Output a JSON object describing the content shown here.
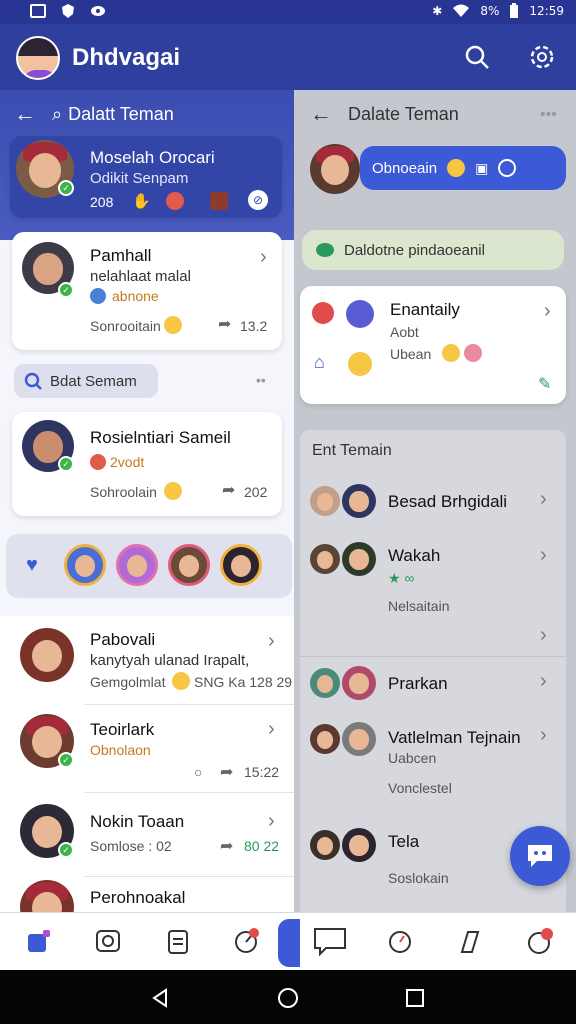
{
  "status_bar": {
    "battery": "8%",
    "time": "12:59"
  },
  "header": {
    "title": "Dhdvagai"
  },
  "left": {
    "subheader": "Dalatt Teman",
    "profile": {
      "name": "Moselah Orocari",
      "status": "Odikit Senpam",
      "count": "208"
    },
    "card1": {
      "name": "Pamhall",
      "line1": "nelahlaat malal",
      "tag": "abnone",
      "action": "Sonrooitain",
      "stat": "13.2"
    },
    "search_pill": "Bdat Semam",
    "card2": {
      "name": "Rosielntiari Sameil",
      "tag": "2vodt",
      "action": "Sohroolain",
      "stat": "202"
    },
    "list": [
      {
        "name": "Pabovali",
        "line1": "kanytyah ulanad Irapalt,",
        "line2": "Gemgolmlat",
        "extra": "SNG Ka 128 29"
      },
      {
        "name": "Teoirlark",
        "line1": "Obnolaon",
        "line2": "",
        "extra": "15:22"
      },
      {
        "name": "Nokin Toaan",
        "line1": "Somlose : 02",
        "line2": "",
        "extra": "80 22"
      },
      {
        "name": "Perohnoakal",
        "line1": "",
        "line2": "",
        "extra": ""
      }
    ]
  },
  "right": {
    "subheader": "Dalate Teman",
    "bubble": "Obnoeain",
    "pill": "Daldotne pindaoeanil",
    "card": {
      "name": "Enantaily",
      "line1": "Aobt",
      "line2": "Ubean"
    },
    "section": "Ent Temain",
    "list": [
      {
        "name": "Besad Brhgidali",
        "sub": ""
      },
      {
        "name": "Wakah",
        "sub": "Nelsaitain"
      },
      {
        "name": "Prarkan",
        "sub": ""
      },
      {
        "name": "Vatlelman Tejnain",
        "sub": "Uabcen",
        "sub2": "Vonclestel"
      },
      {
        "name": "Tela",
        "sub": "Soslokain"
      }
    ]
  },
  "colors": {
    "primary": "#2f3f9e",
    "accent": "#3d5ad6",
    "online": "#3bb44a"
  }
}
